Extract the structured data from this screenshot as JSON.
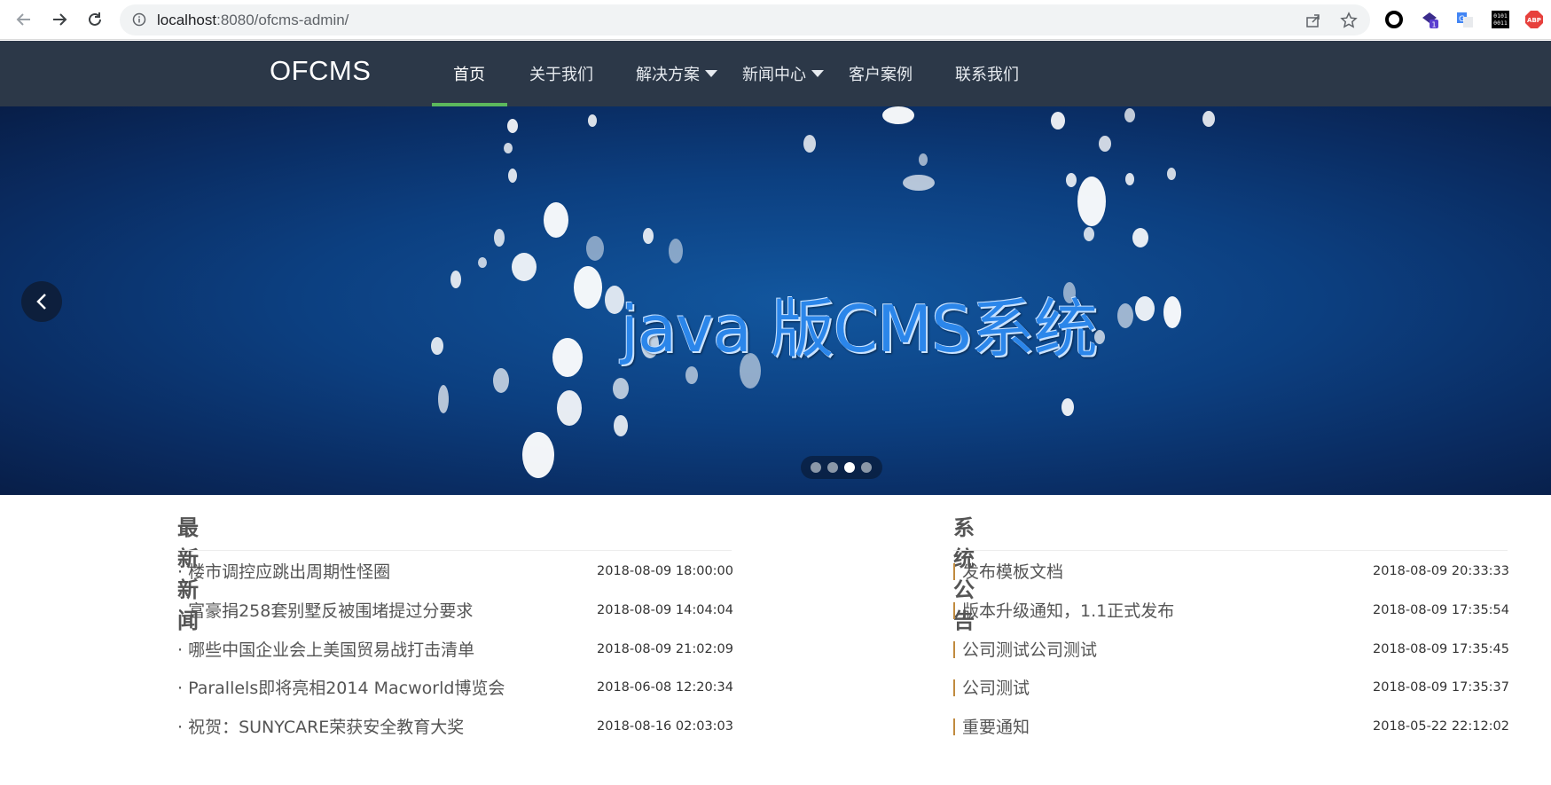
{
  "browser": {
    "url_host": "localhost",
    "url_rest": ":8080/ofcms-admin/"
  },
  "site": {
    "logo": "OFCMS",
    "menu": [
      {
        "label": "首页",
        "active": true
      },
      {
        "label": "关于我们"
      },
      {
        "label": "解决方案",
        "dropdown": true
      },
      {
        "label": "新闻中心",
        "dropdown": true
      },
      {
        "label": "客户案例"
      },
      {
        "label": "联系我们"
      }
    ]
  },
  "banner": {
    "title": "java 版CMS系统",
    "slides_count": 4,
    "active_slide": 3
  },
  "news": {
    "title": "最新新闻",
    "items": [
      {
        "title": "楼市调控应跳出周期性怪圈",
        "date": "2018-08-09 18:00:00"
      },
      {
        "title": "富豪捐258套别墅反被围堵提过分要求",
        "date": "2018-08-09 14:04:04"
      },
      {
        "title": "哪些中国企业会上美国贸易战打击清单",
        "date": "2018-08-09 21:02:09"
      },
      {
        "title": "Parallels即将亮相2014 Macworld博览会",
        "date": "2018-06-08 12:20:34"
      },
      {
        "title": "祝贺：SUNYCARE荣获安全教育大奖",
        "date": "2018-08-16 02:03:03"
      }
    ]
  },
  "notices": {
    "title": "系统公告",
    "items": [
      {
        "title": "发布模板文档",
        "date": "2018-08-09 20:33:33"
      },
      {
        "title": "版本升级通知，1.1正式发布",
        "date": "2018-08-09 17:35:54"
      },
      {
        "title": "公司测试公司测试",
        "date": "2018-08-09 17:35:45"
      },
      {
        "title": "公司测试",
        "date": "2018-08-09 17:35:37"
      },
      {
        "title": "重要通知",
        "date": "2018-05-22 22:12:02"
      }
    ]
  },
  "colors": {
    "header_bg": "#2c3848",
    "active_underline": "#5cb85c",
    "banner_bg": "#0c3f80",
    "banner_title": "#2b86ea"
  }
}
